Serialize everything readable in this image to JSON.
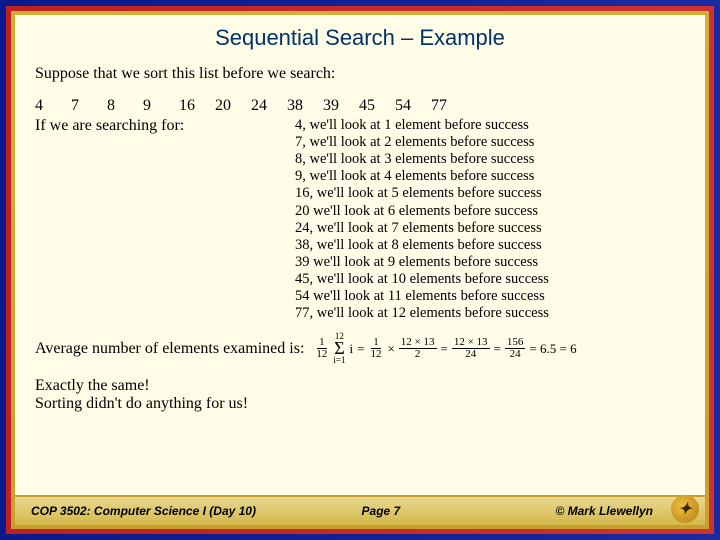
{
  "title": "Sequential Search – Example",
  "intro": "Suppose that we sort this list before we search:",
  "numbers": [
    "4",
    "7",
    "8",
    "9",
    "16",
    "20",
    "24",
    "38",
    "39",
    "45",
    "54",
    "77"
  ],
  "searching_for": "If we are searching for:",
  "search_lines": [
    "4, we'll look at 1 element before success",
    "7, we'll look at 2 elements before success",
    "8, we'll look at 3 elements before success",
    "9, we'll look at 4 elements before success",
    "16, we'll look at 5 elements before success",
    "20 we'll look at 6 elements before success",
    "24, we'll look at 7 elements before success",
    "38, we'll look at 8 elements before success",
    "39 we'll look at 9 elements before success",
    "45, we'll look at 10 elements before success",
    "54 we'll look at 11 elements before success",
    "77, we'll look at 12 elements before success"
  ],
  "avg_label": "Average number of elements examined is:",
  "formula": {
    "f1_num": "1",
    "f1_den": "12",
    "sigma_top": "12",
    "sigma_bot": "i=1",
    "sigma_var": "i",
    "eq1": "=",
    "f2_num": "1",
    "f2_den": "12",
    "times": "×",
    "f3_num": "12 × 13",
    "f3_den": "2",
    "eq2": "=",
    "f4_num": "12 × 13",
    "f4_den": "24",
    "eq3": "=",
    "f5_num": "156",
    "f5_den": "24",
    "eq4": "= 6.5 = 6"
  },
  "conclusion_1": "Exactly the same!",
  "conclusion_2": "Sorting didn't do anything for us!",
  "footer": {
    "left": "COP 3502: Computer Science I  (Day 10)",
    "mid": "Page 7",
    "right": "© Mark Llewellyn"
  }
}
